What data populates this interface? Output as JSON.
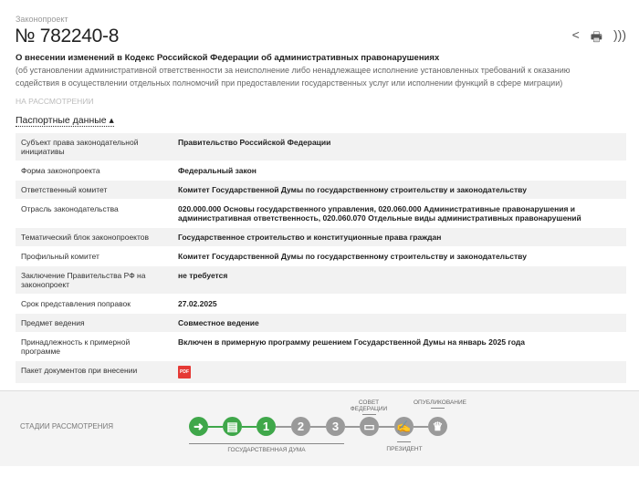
{
  "header": {
    "type_label": "Законопроект",
    "number": "№ 782240-8",
    "name": "О внесении изменений в Кодекс Российской Федерации об административных правонарушениях",
    "description": "(об установлении административной ответственности за неисполнение либо ненадлежащее исполнение установленных требований к оказанию содействия в осуществлении отдельных полномочий при предоставлении государственных услуг или исполнении функций в сфере миграции)",
    "status": "НА РАССМОТРЕНИИ"
  },
  "actions": {
    "share_icon": "share-icon",
    "print_icon": "print-icon",
    "rss_icon": "rss-icon"
  },
  "passport": {
    "toggle_label": "Паспортные данные ▴",
    "rows": [
      {
        "label": "Субъект права законодательной инициативы",
        "value": "Правительство Российской Федерации"
      },
      {
        "label": "Форма законопроекта",
        "value": "Федеральный закон"
      },
      {
        "label": "Ответственный комитет",
        "value": "Комитет Государственной Думы по государственному строительству и законодательству"
      },
      {
        "label": "Отрасль законодательства",
        "value": "020.000.000 Основы государственного управления, 020.060.000 Административные правонарушения и административная ответственность, 020.060.070 Отдельные виды административных правонарушений"
      },
      {
        "label": "Тематический блок законопроектов",
        "value": "Государственное строительство и конституционные права граждан"
      },
      {
        "label": "Профильный комитет",
        "value": "Комитет Государственной Думы по государственному строительству и законодательству"
      },
      {
        "label": "Заключение Правительства РФ на законопроект",
        "value": "не требуется"
      },
      {
        "label": "Срок представления поправок",
        "value": "27.02.2025"
      },
      {
        "label": "Предмет ведения",
        "value": "Совместное ведение"
      },
      {
        "label": "Принадлежность к примерной программе",
        "value": "Включен в примерную программу решением Государственной Думы на январь 2025 года"
      },
      {
        "label": "Пакет документов при внесении",
        "value": "PDF"
      }
    ]
  },
  "stages": {
    "title": "СТАДИИ РАССМОТРЕНИЯ",
    "duma": "ГОСУДАРСТВЕННАЯ ДУМА",
    "council": "СОВЕТ ФЕДЕРАЦИИ",
    "president": "ПРЕЗИДЕНТ",
    "publication": "ОПУБЛИКОВАНИЕ",
    "steps": [
      {
        "glyph": "➜",
        "done": true
      },
      {
        "glyph": "▤",
        "done": true
      },
      {
        "glyph": "1",
        "done": true
      },
      {
        "glyph": "2",
        "done": false
      },
      {
        "glyph": "3",
        "done": false
      },
      {
        "glyph": "▭",
        "done": false
      },
      {
        "glyph": "✍",
        "done": false
      },
      {
        "glyph": "♛",
        "done": false
      }
    ]
  },
  "colors": {
    "done": "#3fa74a",
    "pending": "#9a9a9a",
    "pdf": "#e53935"
  }
}
